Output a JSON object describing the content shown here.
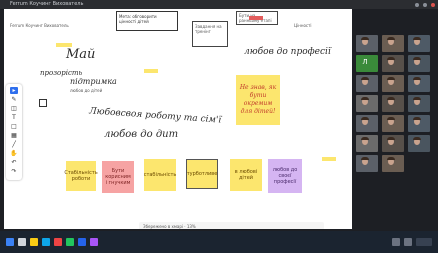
{
  "board": {
    "top_labels": [
      "Ferrum Коучинг Вихователь",
      "Мета: обговорити цінності дітей",
      "Завдання на тренінг",
      "Бути на ранньому етапі",
      "Цінності"
    ],
    "handwriting": [
      "Май",
      "прозорість",
      "підтримка",
      "любов до дітей",
      "любов до професії",
      "Любовсвоя роботу та сім'ї",
      "любов до дит"
    ],
    "sticky_top": "Не знав, як бути окремим для дітей!",
    "stickies": [
      "Стабільність роботи",
      "Бути корисним і гнучким",
      "стабільність",
      "турботливе",
      "в любові дітей",
      "любов до своєї професії"
    ],
    "bottom_bar": "Збережено в хмарі · 13%"
  },
  "toolbar": {
    "tools": [
      "pointer-icon",
      "pen-icon",
      "eraser-icon",
      "text-icon",
      "shape-icon",
      "sticky-icon",
      "line-icon",
      "hand-icon",
      "undo-icon",
      "redo-icon"
    ]
  },
  "participants": {
    "letters": [
      "Л"
    ],
    "count": 20
  },
  "colors": {
    "sticky_yellow": "#fce66e",
    "sticky_pink": "#f6a3a3",
    "sticky_purple": "#d5b5f2",
    "board_bg": "#ffffff",
    "window_bg": "#1d1f24",
    "taskbar_bg": "#1b2430"
  }
}
